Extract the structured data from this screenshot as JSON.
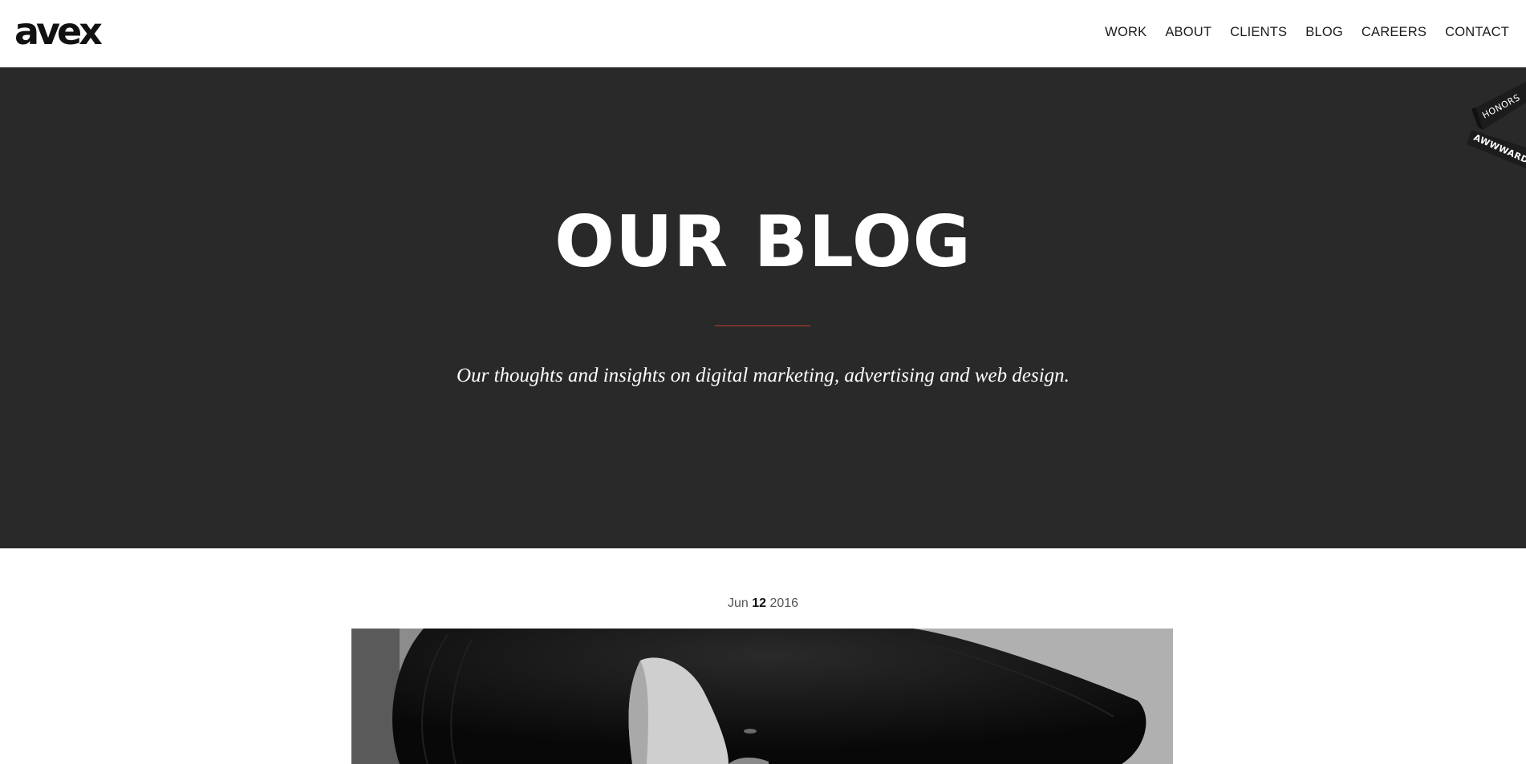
{
  "header": {
    "logo": "avex",
    "nav": [
      {
        "label": "WORK"
      },
      {
        "label": "ABOUT"
      },
      {
        "label": "CLIENTS"
      },
      {
        "label": "BLOG"
      },
      {
        "label": "CAREERS"
      },
      {
        "label": "CONTACT"
      }
    ]
  },
  "hero": {
    "title": "OUR BLOG",
    "subtitle": "Our thoughts and insights on digital marketing, advertising and web design.",
    "divider_color": "#c0392b",
    "background_color": "#292929"
  },
  "awards_badge": {
    "top_text": "HONORS",
    "bottom_text": "AWWWARDS"
  },
  "post": {
    "date": {
      "month": "Jun",
      "day": "12",
      "year": "2016"
    },
    "image_icon": "woman-black-hat-photo"
  }
}
